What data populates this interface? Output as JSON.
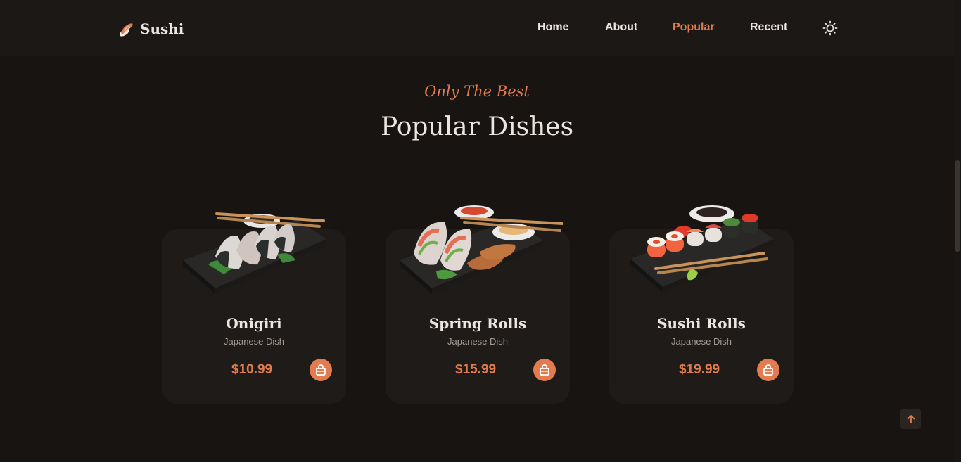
{
  "header": {
    "brand": "Sushi",
    "nav": [
      {
        "label": "Home",
        "active": false
      },
      {
        "label": "About",
        "active": false
      },
      {
        "label": "Popular",
        "active": true
      },
      {
        "label": "Recent",
        "active": false
      }
    ],
    "theme_icon": "sun-icon"
  },
  "section": {
    "subtitle": "Only The Best",
    "title": "Popular Dishes"
  },
  "dishes": [
    {
      "name": "Onigiri",
      "type": "Japanese Dish",
      "price": "$10.99"
    },
    {
      "name": "Spring Rolls",
      "type": "Japanese Dish",
      "price": "$15.99"
    },
    {
      "name": "Sushi Rolls",
      "type": "Japanese Dish",
      "price": "$19.99"
    }
  ],
  "colors": {
    "accent": "#e27b4e",
    "background": "#181412",
    "card": "#1f1b19",
    "text": "#ece6e2",
    "muted": "#a59c97"
  },
  "icons": {
    "cart": "shopping-bag-icon",
    "scroll_up": "arrow-up-icon",
    "logo": "sushi-logo-icon"
  }
}
